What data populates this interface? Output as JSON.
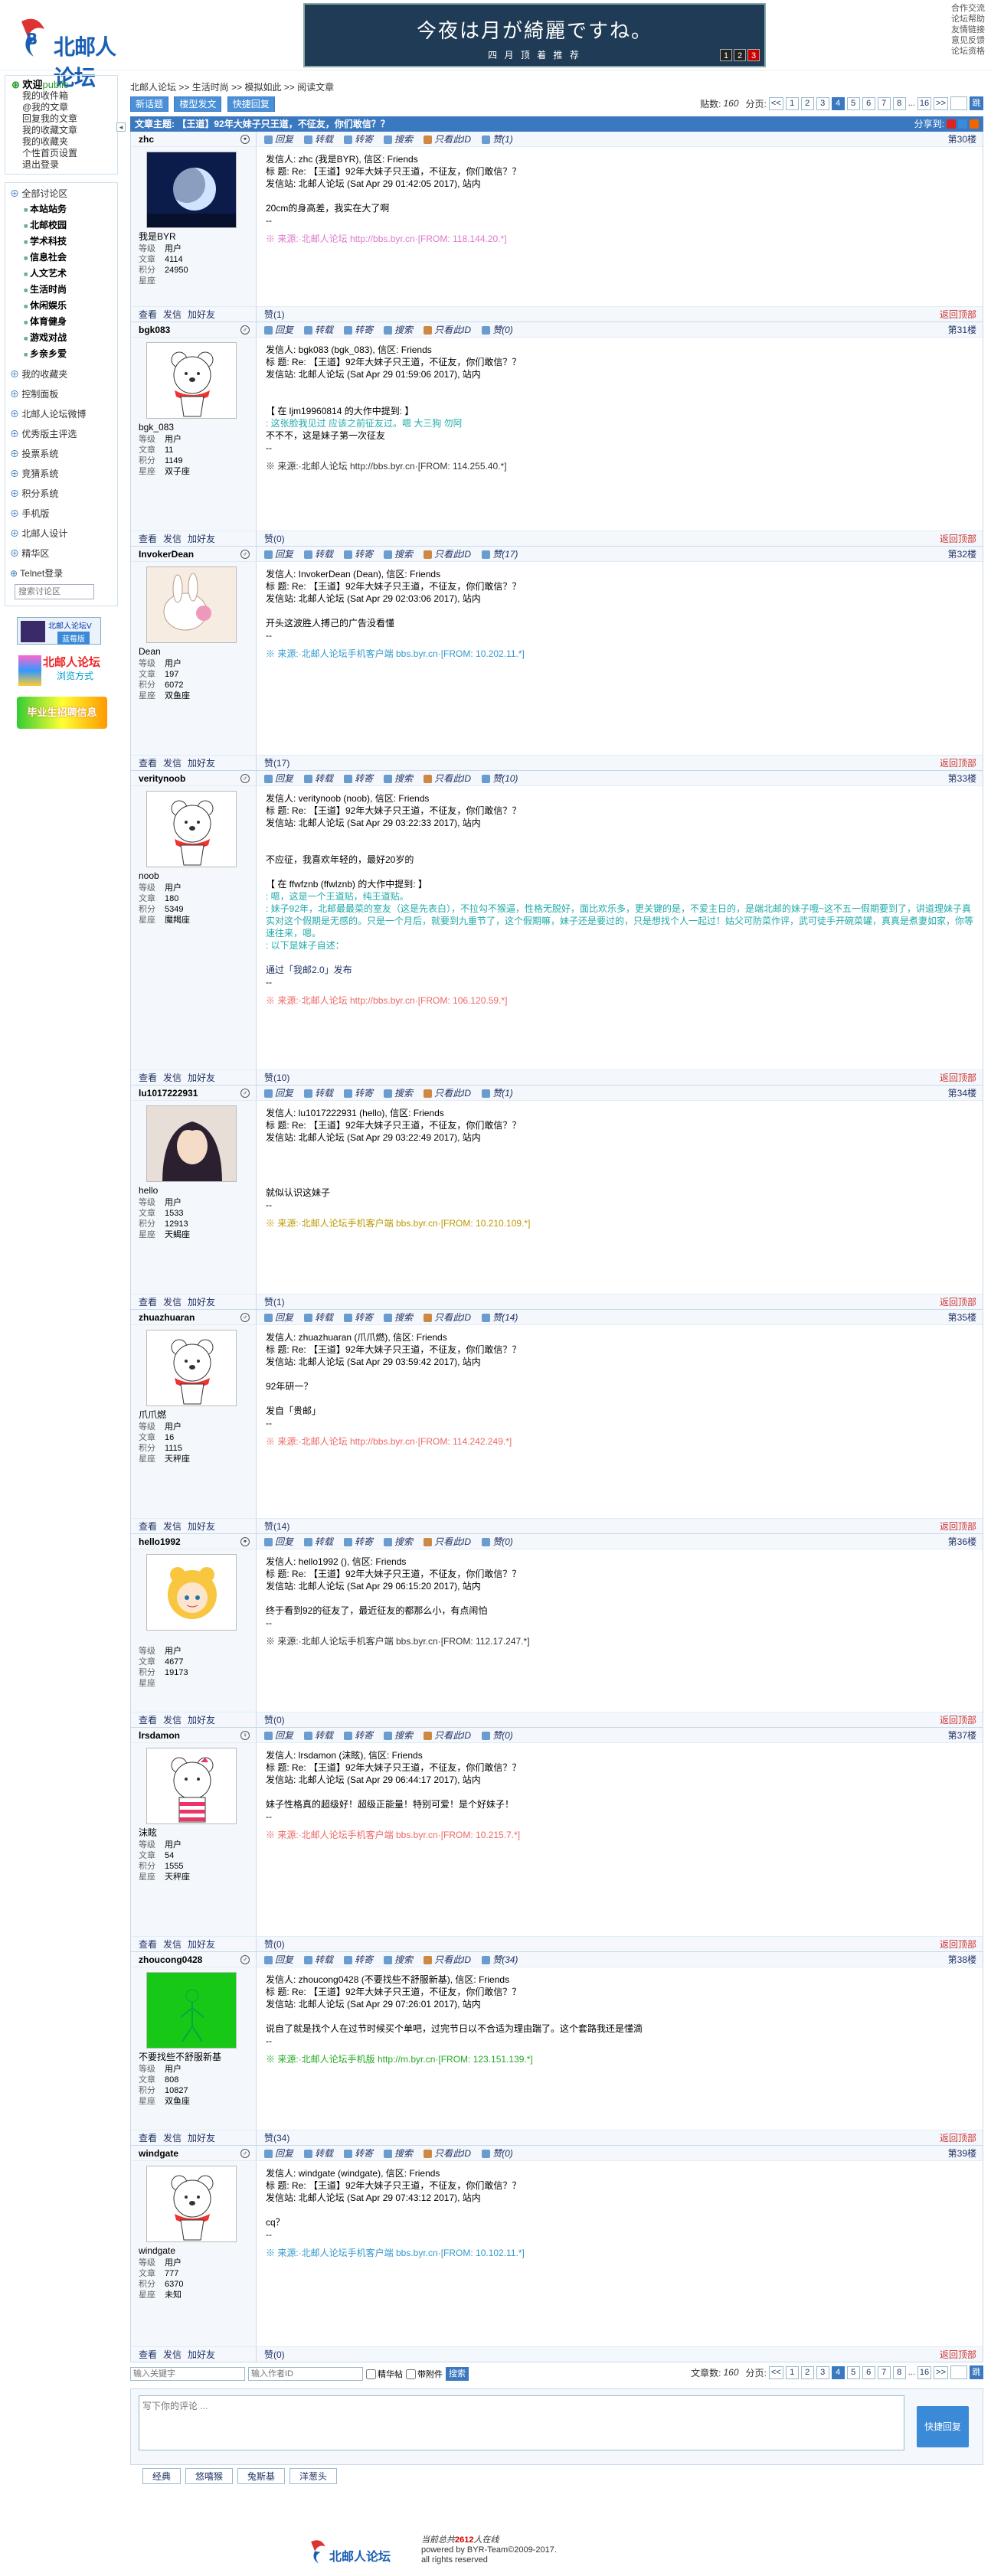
{
  "site": {
    "name": "北邮人论坛"
  },
  "banner": {
    "line1": "今夜は月が綺麗ですね。",
    "line2": "四 月 顶 着 推 荐",
    "pages": [
      "1",
      "2",
      "3"
    ]
  },
  "toplinks": [
    "合作交流",
    "论坛帮助",
    "友情链接",
    "意见反馈",
    "论坛资格"
  ],
  "sidebar": {
    "welcome": "欢迎",
    "welcome_user": "public",
    "user_links": [
      "我的收件箱",
      "@我的文章",
      "回复我的文章",
      "我的收藏文章",
      "我的收藏夹",
      "个性首页设置",
      "退出登录"
    ],
    "sections": [
      {
        "label": "全部讨论区",
        "subs": [
          "本站站务",
          "北邮校园",
          "学术科技",
          "信息社会",
          "人文艺术",
          "生活时尚",
          "休闲娱乐",
          "体育健身",
          "游戏对战",
          "乡亲乡爱"
        ]
      },
      {
        "label": "我的收藏夹",
        "subs": []
      },
      {
        "label": "控制面板",
        "subs": []
      },
      {
        "label": "北邮人论坛微博",
        "subs": []
      },
      {
        "label": "优秀版主评选",
        "subs": []
      },
      {
        "label": "投票系统",
        "subs": []
      },
      {
        "label": "竞猜系统",
        "subs": []
      },
      {
        "label": "积分系统",
        "subs": []
      },
      {
        "label": "手机版",
        "subs": []
      },
      {
        "label": "北邮人设计",
        "subs": []
      },
      {
        "label": "精华区",
        "subs": []
      },
      {
        "label": "Telnet登录",
        "subs": []
      }
    ],
    "search_placeholder": "搜索讨论区",
    "ad1_title": "北邮人论坛V",
    "ad1_sub": "蓝莓版",
    "ad2_title": "北邮人论坛",
    "ad2_sub": "浏览方式",
    "ad3": "毕业生招聘信息"
  },
  "breadcrumb": [
    "北邮人论坛",
    ">>",
    "生活时尚",
    ">>",
    "模拟如此",
    ">>",
    "阅读文章"
  ],
  "toolbar": {
    "new_post": "新话题",
    "post_mode": "楼型发文",
    "quick_reply": "快捷回复",
    "post_count_label": "贴数:",
    "post_count": "160",
    "page_label": "分页:",
    "pages": [
      "<<",
      "1",
      "2",
      "3",
      "4",
      "5",
      "6",
      "7",
      "8",
      "...",
      "16",
      ">>"
    ],
    "current_page": "4",
    "go": "跳"
  },
  "subject": {
    "label": "文章主题:",
    "title": "【王道】92年大妹子只王道，不征友，你们敢信？？",
    "share": "分享到:",
    "share_colors": [
      "#d22",
      "#3a8ad8",
      "#e60"
    ]
  },
  "posts": [
    {
      "user": "zhc",
      "uid": "我是BYR",
      "level": "用户",
      "posts": "4114",
      "score": "24950",
      "star": "",
      "floor": "第30楼",
      "gender": "⚬",
      "fav": "赞(1)",
      "avatar": "moon",
      "lines": [
        "发信人: zhc (我是BYR), 信区: Friends",
        "标  题: Re: 【王道】92年大妹子只王道，不征友，你们敢信？？",
        "发信站: 北邮人论坛 (Sat Apr 29 01:42:05 2017), 站内",
        "",
        "20cm的身高差，我实在大了啊",
        "--"
      ],
      "quote": [],
      "source": "※ 来源:·北邮人论坛 http://bbs.byr.cn·[FROM: 118.144.20.*]",
      "src_color": "#d7c"
    },
    {
      "user": "bgk083",
      "uid": "bgk_083",
      "level": "用户",
      "posts": "11",
      "score": "1149",
      "star": "双子座",
      "floor": "第31楼",
      "gender": "♂",
      "fav": "赞(0)",
      "avatar": "bear",
      "lines": [
        "发信人: bgk083 (bgk_083), 信区: Friends",
        "标  题: Re: 【王道】92年大妹子只王道，不征友，你们敢信？？",
        "发信站: 北邮人论坛 (Sat Apr 29 01:59:06 2017), 站内",
        "",
        ""
      ],
      "quote": [
        "【 在 ljm19960814 的大作中提到: 】",
        ": 这张脸我见过 应该之前征友过。嗯 大三狗 勿阿"
      ],
      "after": [
        "不不不，这是妹子第一次征友",
        "--"
      ],
      "source": "※ 来源:·北邮人论坛 http://bbs.byr.cn·[FROM: 114.255.40.*]",
      "src_color": "#333"
    },
    {
      "user": "InvokerDean",
      "uid": "Dean",
      "level": "用户",
      "posts": "197",
      "score": "6072",
      "star": "双鱼座",
      "floor": "第32楼",
      "gender": "♂",
      "fav": "赞(17)",
      "avatar": "rabbit",
      "lines": [
        "发信人: InvokerDean (Dean), 信区: Friends",
        "标  题: Re: 【王道】92年大妹子只王道，不征友，你们敢信？？",
        "发信站: 北邮人论坛 (Sat Apr 29 02:03:06 2017), 站内",
        "",
        "开头这波胜人搏己的广告没看懂",
        "--"
      ],
      "quote": [],
      "source": "※ 来源:·北邮人论坛手机客户端 bbs.byr.cn·[FROM: 10.202.11.*]",
      "src_color": "#39c"
    },
    {
      "user": "veritynoob",
      "uid": "noob",
      "level": "用户",
      "posts": "180",
      "score": "5349",
      "star": "魔羯座",
      "floor": "第33楼",
      "gender": "♂",
      "fav": "赞(10)",
      "avatar": "bear",
      "lines": [
        "发信人: veritynoob (noob), 信区: Friends",
        "标  题: Re: 【王道】92年大妹子只王道，不征友，你们敢信？？",
        "发信站: 北邮人论坛 (Sat Apr 29 03:22:33 2017), 站内",
        "",
        "",
        "不应征，我喜欢年轻的，最好20岁的",
        ""
      ],
      "quote": [
        "【 在 ffwfznb (ffwlznb) 的大作中提到: 】",
        ": 嗯，这是一个王道贴，纯王道贴。",
        ": 妹子92年，北邮最最菜的室友（这是先表白），不拉勾不猴逼，性格无脱好，面比欢乐多，更关键的是，不爱主日的，是端北邮的妹子哦~这不五一假期要到了，讲道理妹子真实对这个假期是无感的。只是一个月后，就要到九重节了，这个假期嘛，妹子还是要过的，只是想找个人一起过！姑父可防菜作评，武可徒手开碗菜罐，真真是煮妻如家，你等速往来，嗯。",
        ": 以下是妹子自述："
      ],
      "after": [
        "",
        "通过「我邮2.0」发布",
        "--"
      ],
      "source": "※ 来源:·北邮人论坛 http://bbs.byr.cn·[FROM: 106.120.59.*]",
      "src_color": "#e66"
    },
    {
      "user": "lu1017222931",
      "uid": "hello",
      "level": "用户",
      "posts": "1533",
      "score": "12913",
      "star": "天蝎座",
      "floor": "第34楼",
      "gender": "♂",
      "fav": "赞(1)",
      "avatar": "anime",
      "lines": [
        "发信人: lu1017222931 (hello), 信区: Friends",
        "标  题: Re: 【王道】92年大妹子只王道，不征友，你们敢信？？",
        "发信站: 北邮人论坛 (Sat Apr 29 03:22:49 2017), 站内",
        "",
        "",
        "就似认识这妹子",
        "--"
      ],
      "quote": [],
      "source": "※ 来源:·北邮人论坛手机客户端 bbs.byr.cn·[FROM: 10.210.109.*]",
      "src_color": "#b90"
    },
    {
      "user": "zhuazhuaran",
      "uid": "爪爪燃",
      "level": "用户",
      "posts": "16",
      "score": "1115",
      "star": "天秤座",
      "floor": "第35楼",
      "gender": "♂",
      "fav": "赞(14)",
      "avatar": "bear",
      "lines": [
        "发信人: zhuazhuaran (爪爪燃), 信区: Friends",
        "标  题: Re: 【王道】92年大妹子只王道，不征友，你们敢信？？",
        "发信站: 北邮人论坛 (Sat Apr 29 03:59:42 2017), 站内",
        "",
        "92年研一？",
        "",
        "发自「贵邮」",
        "--"
      ],
      "quote": [],
      "source": "※ 来源:·北邮人论坛 http://bbs.byr.cn·[FROM: 114.242.249.*]",
      "src_color": "#e66"
    },
    {
      "user": "hello1992",
      "uid": "",
      "level": "用户",
      "posts": "4677",
      "score": "19173",
      "star": "",
      "floor": "第36楼",
      "gender": "⚬",
      "fav": "赞(0)",
      "avatar": "sailor",
      "lines": [
        "发信人: hello1992 (), 信区: Friends",
        "标  题: Re: 【王道】92年大妹子只王道，不征友，你们敢信？？",
        "发信站: 北邮人论坛 (Sat Apr 29 06:15:20 2017), 站内",
        "",
        "终于看到92的征友了，最近征友的都那么小，有点闹怕",
        "--"
      ],
      "quote": [],
      "source": "※ 来源:·北邮人论坛手机客户端 bbs.byr.cn·[FROM: 112.17.247.*]",
      "src_color": "#333"
    },
    {
      "user": "lrsdamon",
      "uid": "沫眩",
      "level": "用户",
      "posts": "54",
      "score": "1555",
      "star": "天秤座",
      "floor": "第37楼",
      "gender": "♀",
      "fav": "赞(0)",
      "avatar": "bearpink",
      "lines": [
        "发信人: lrsdamon (沫眩), 信区: Friends",
        "标  题: Re: 【王道】92年大妹子只王道，不征友，你们敢信？？",
        "发信站: 北邮人论坛 (Sat Apr 29 06:44:17 2017), 站内",
        "",
        "妹子性格真的超级好！超级正能量！特别可爱！是个好妹子！",
        "--"
      ],
      "quote": [],
      "source": "※ 来源:·北邮人论坛手机客户端 bbs.byr.cn·[FROM: 10.215.7.*]",
      "src_color": "#e66"
    },
    {
      "user": "zhoucong0428",
      "uid": "不要找些不舒服新基",
      "level": "用户",
      "posts": "808",
      "score": "10827",
      "star": "双鱼座",
      "floor": "第38楼",
      "gender": "♂",
      "fav": "赞(34)",
      "avatar": "green",
      "lines": [
        "发信人: zhoucong0428 (不要找些不舒服新基), 信区: Friends",
        "标  题: Re: 【王道】92年大妹子只王道，不征友，你们敢信？？",
        "发信站: 北邮人论坛 (Sat Apr 29 07:26:01 2017), 站内",
        "",
        "说自了就是找个人在过节时候买个单吧，过完节日以不合适为理由踹了。这个套路我还是懂滴",
        "--"
      ],
      "quote": [],
      "source": "※ 来源:·北邮人论坛手机版 http://m.byr.cn·[FROM: 123.151.139.*]",
      "src_color": "#2a2"
    },
    {
      "user": "windgate",
      "uid": "windgate",
      "level": "用户",
      "posts": "777",
      "score": "6370",
      "star": "未知",
      "floor": "第39楼",
      "gender": "♂",
      "fav": "赞(0)",
      "avatar": "bear",
      "lines": [
        "发信人: windgate (windgate), 信区: Friends",
        "标  题: Re: 【王道】92年大妹子只王道，不征友，你们敢信？？",
        "发信站: 北邮人论坛 (Sat Apr 29 07:43:12 2017), 站内",
        "",
        "cq？",
        "--"
      ],
      "quote": [],
      "source": "※ 来源:·北邮人论坛手机客户端 bbs.byr.cn·[FROM: 10.102.11.*]",
      "src_color": "#39c"
    }
  ],
  "labels": {
    "level": "等级",
    "posts": "文章",
    "score": "积分",
    "star": "星座",
    "reply": "回复",
    "forward": "转载",
    "transfer": "转寄",
    "search": "搜索",
    "author_only": "只看此ID",
    "view": "查看",
    "mail": "发信",
    "add_friend": "加好友",
    "back_top": "返回顶部"
  },
  "bottom": {
    "kw_placeholder": "输入关键字",
    "author_placeholder": "输入作者ID",
    "cb1": "精华帖",
    "cb2": "带附件",
    "search": "搜索",
    "post_count_label": "文章数:",
    "post_count": "160",
    "page_label": "分页:"
  },
  "reply": {
    "placeholder": "写下你的评论 ...",
    "button": "快捷回复",
    "tabs": [
      "经典",
      "悠嘻猴",
      "兔斯基",
      "洋葱头"
    ]
  },
  "footer": {
    "online_prefix": "当前总共",
    "online": "2612",
    "online_suffix": "人在线",
    "powered": "powered by BYR-Team©2009-2017.",
    "rights": "all rights reserved"
  }
}
